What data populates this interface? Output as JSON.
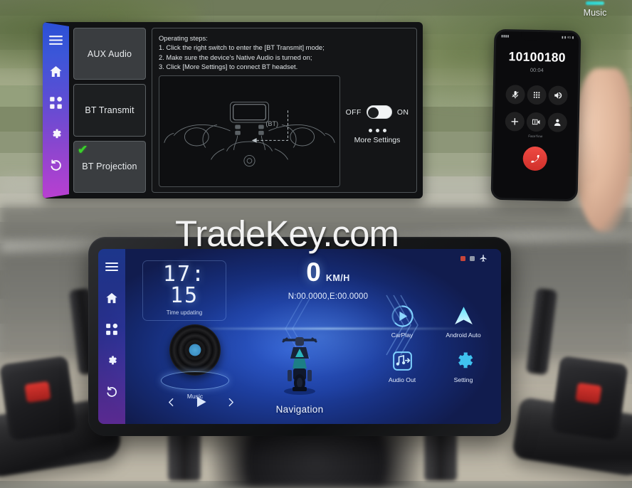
{
  "watermark": "TradeKey.com",
  "music_corner": {
    "label": "Music",
    "icon": "music-bar-icon"
  },
  "settings_panel": {
    "rail_icons": [
      "menu-icon",
      "home-icon",
      "apps-icon",
      "gear-icon",
      "back-icon"
    ],
    "mode_buttons": [
      {
        "label": "AUX Audio",
        "selected": false,
        "checked": false
      },
      {
        "label": "BT Transmit",
        "selected": false,
        "checked": false
      },
      {
        "label": "BT Projection",
        "selected": true,
        "checked": true,
        "check_glyph": "✔"
      }
    ],
    "steps_text": "Operating steps:\n1. Click the right switch to enter the [BT Transmit] mode;\n2. Make sure the device's Native Audio is turned on;\n3. Click [More Settings] to connect     BT      headset.",
    "diagram_bt_label": "(BT)",
    "toggle": {
      "off_label": "OFF",
      "on_label": "ON",
      "state": "off"
    },
    "more_settings_label": "More Settings",
    "more_settings_icon": "ellipsis-icon"
  },
  "phone": {
    "status_left": "▮▮▮▮",
    "status_right": "▮ ▮ 4G ▮",
    "number": "10100180",
    "call_timer": "00:04",
    "buttons": [
      {
        "name": "mute-button",
        "icon": "mic-muted-icon",
        "sub": ""
      },
      {
        "name": "keypad-button",
        "icon": "keypad-icon",
        "sub": ""
      },
      {
        "name": "speaker-button",
        "icon": "speaker-icon",
        "sub": ""
      },
      {
        "name": "add-call-button",
        "icon": "plus-icon",
        "sub": ""
      },
      {
        "name": "facetime-button",
        "icon": "video-camera-icon",
        "sub": "FaceTime"
      },
      {
        "name": "contacts-button",
        "icon": "person-icon",
        "sub": ""
      }
    ],
    "end_call": {
      "label": "",
      "icon": "end-call-icon",
      "color": "#e0392f"
    }
  },
  "device": {
    "rail_icons": [
      "menu-icon",
      "home-icon",
      "apps-icon",
      "gear-icon",
      "back-icon"
    ],
    "status_icons": [
      "status-red-dot",
      "status-gray-dot",
      "airplane-mode-icon"
    ],
    "clock": {
      "time": "17: 15",
      "sub_label": "Time updating"
    },
    "speed": {
      "value": "0",
      "unit": "KM/H"
    },
    "gps": "N:00.0000,E:00.0000",
    "music_widget": {
      "label": "Music",
      "icon": "vinyl-record-icon"
    },
    "media_controls": [
      {
        "name": "previous-track-button",
        "icon": "chevron-left-icon"
      },
      {
        "name": "play-button",
        "icon": "play-icon"
      },
      {
        "name": "next-track-button",
        "icon": "chevron-right-icon"
      }
    ],
    "navigation_label": "Navigation",
    "apps": [
      {
        "label": "CarPlay",
        "icon": "carplay-icon"
      },
      {
        "label": "Android Auto",
        "icon": "android-auto-icon"
      },
      {
        "label": "Audio Out",
        "icon": "audio-out-icon"
      },
      {
        "label": "Setting",
        "icon": "gear-icon"
      }
    ]
  },
  "colors": {
    "accent_blue": "#2b57c8",
    "accent_purple": "#8b2fc0",
    "check_green": "#39d12a",
    "end_call_red": "#e0392f",
    "screen_text": "#eef4ff"
  }
}
